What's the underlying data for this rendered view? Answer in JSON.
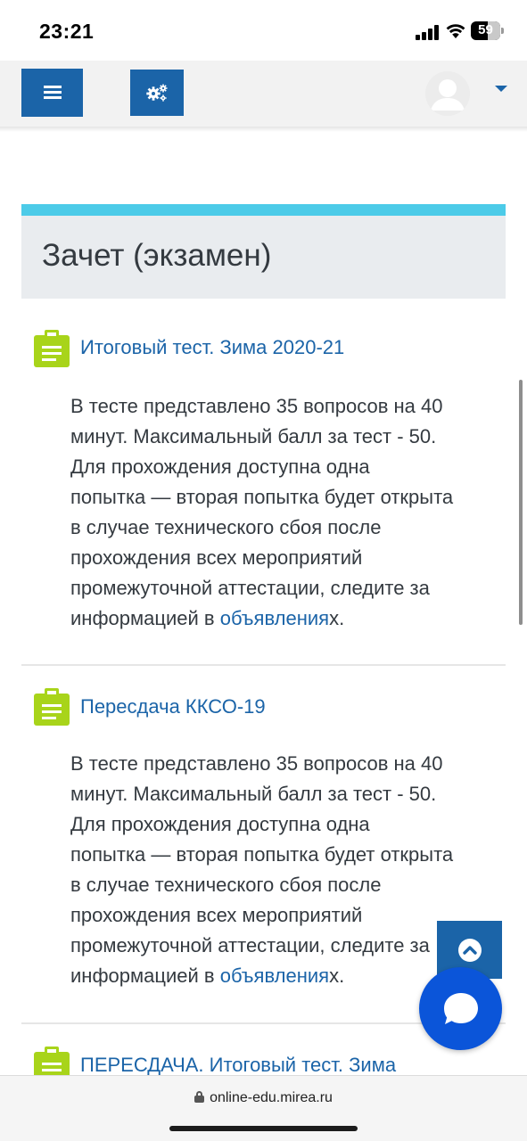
{
  "status_bar": {
    "time": "23:21",
    "battery_level": "59",
    "battery_fraction": 0.59
  },
  "navbar": {
    "menu_icon": "hamburger-icon",
    "settings_icon": "gears-icon",
    "avatar_icon": "user-avatar-icon",
    "user_menu_icon": "caret-down-icon",
    "accent_color": "#1b64a8"
  },
  "section": {
    "title": "Зачет (экзамен)",
    "stripe_color": "#4ccbe8"
  },
  "activities": [
    {
      "icon": "quiz-clipboard-icon",
      "title": "Итоговый тест. Зима 2020-21",
      "desc_lines": [
        "В тесте представлено 35 вопросов на 40",
        "минут. Максимальный балл за тест - 50.",
        "Для прохождения доступна одна",
        "попытка — вторая попытка будет открыта",
        "в случае технического сбоя после",
        "прохождения всех мероприятий",
        "промежуточной аттестации, следите за"
      ],
      "desc_last_prefix": "информацией в ",
      "desc_link": "объявления",
      "desc_last_suffix": "х."
    },
    {
      "icon": "quiz-clipboard-icon",
      "title": "Пересдача ККСО-19",
      "desc_lines": [
        "В тесте представлено 35 вопросов на 40",
        "минут. Максимальный балл за тест - 50.",
        "Для прохождения доступна одна",
        "попытка — вторая попытка будет открыта",
        "в случае технического сбоя после",
        "прохождения всех мероприятий",
        "промежуточной аттестации, следите за"
      ],
      "desc_last_prefix": "информацией в ",
      "desc_link": "объявления",
      "desc_last_suffix": "х."
    },
    {
      "icon": "quiz-clipboard-icon",
      "title": "ПЕРЕСДАЧА. Итоговый тест. Зима"
    }
  ],
  "floating": {
    "to_top_icon": "chevron-up-icon",
    "chat_icon": "chat-bubble-icon"
  },
  "browser": {
    "url": "online-edu.mirea.ru",
    "lock_icon": "lock-icon"
  }
}
